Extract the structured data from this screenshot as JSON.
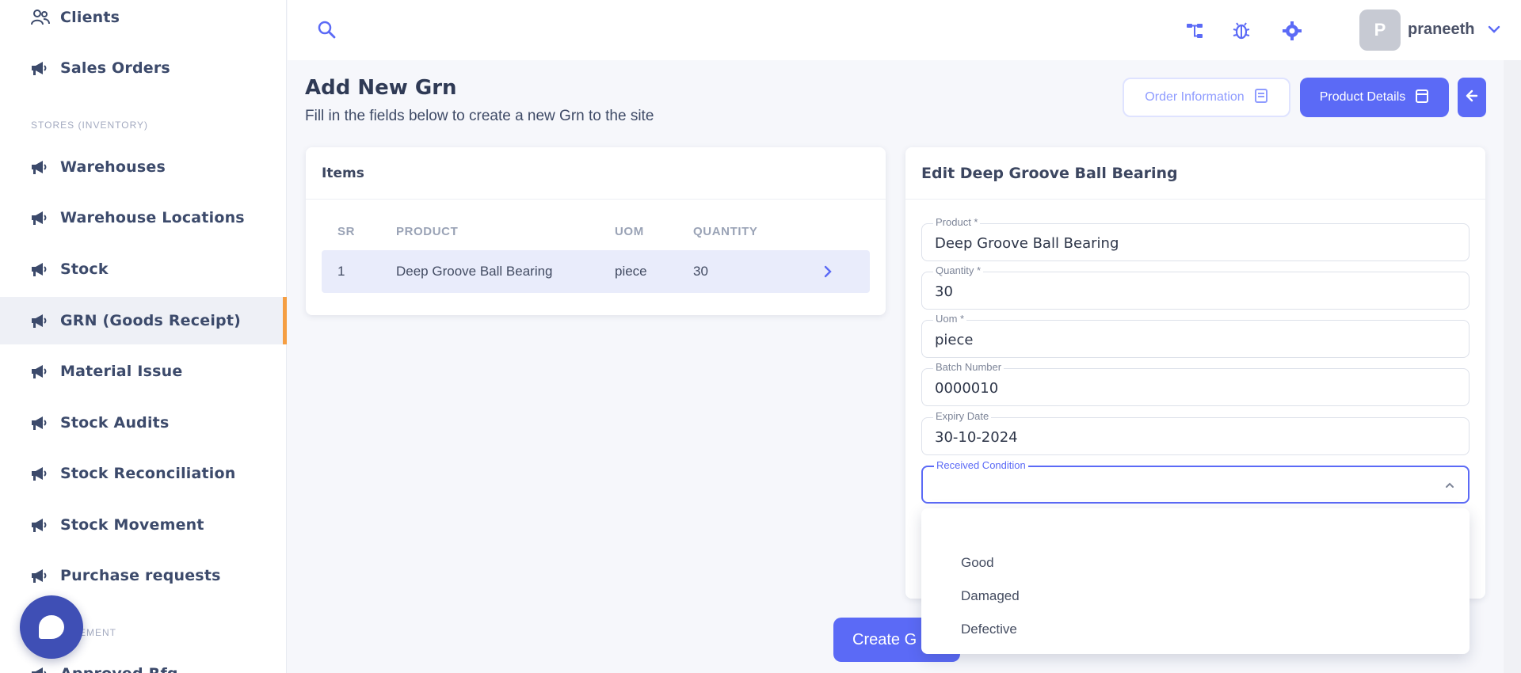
{
  "sidebar": {
    "items": [
      {
        "label": "Clients",
        "icon": "users-icon"
      },
      {
        "label": "Sales Orders",
        "icon": "megaphone-icon"
      },
      {
        "label": "Warehouses",
        "icon": "megaphone-icon"
      },
      {
        "label": "Warehouse Locations",
        "icon": "megaphone-icon"
      },
      {
        "label": "Stock",
        "icon": "megaphone-icon"
      },
      {
        "label": "GRN (Goods Receipt)",
        "icon": "megaphone-icon"
      },
      {
        "label": "Material Issue",
        "icon": "megaphone-icon"
      },
      {
        "label": "Stock Audits",
        "icon": "megaphone-icon"
      },
      {
        "label": "Stock Reconciliation",
        "icon": "megaphone-icon"
      },
      {
        "label": "Stock Movement",
        "icon": "megaphone-icon"
      },
      {
        "label": "Purchase requests",
        "icon": "megaphone-icon"
      },
      {
        "label": "Approved Rfq",
        "icon": "megaphone-icon"
      }
    ],
    "section_stores": "STORES (INVENTORY)",
    "section_procurement": "EMENT"
  },
  "topbar": {
    "avatar_letter": "P",
    "username": "praneeth"
  },
  "page": {
    "title": "Add New Grn",
    "subtitle": "Fill in the fields below to create a new Grn to the site",
    "order_info_button": "Order Information",
    "product_details_button": "Product Details"
  },
  "items_card": {
    "title": "Items",
    "columns": [
      "SR",
      "PRODUCT",
      "UOM",
      "QUANTITY"
    ],
    "rows": [
      {
        "sr": "1",
        "product": "Deep Groove Ball Bearing",
        "uom": "piece",
        "quantity": "30"
      }
    ]
  },
  "edit_card": {
    "title": "Edit Deep Groove Ball Bearing",
    "fields": [
      {
        "label": "Product *",
        "value": "Deep Groove Ball Bearing"
      },
      {
        "label": "Quantity *",
        "value": "30"
      },
      {
        "label": "Uom *",
        "value": "piece"
      },
      {
        "label": "Batch Number",
        "value": "0000010"
      },
      {
        "label": "Expiry Date",
        "value": "30-10-2024"
      },
      {
        "label": "Received Condition",
        "value": ""
      }
    ]
  },
  "dropdown": {
    "options": [
      "Good",
      "Damaged",
      "Defective"
    ]
  },
  "create_button": "Create G",
  "colors": {
    "primary": "#5b6af6",
    "active_marker": "#f59e42",
    "chat": "#3f4fb5"
  }
}
